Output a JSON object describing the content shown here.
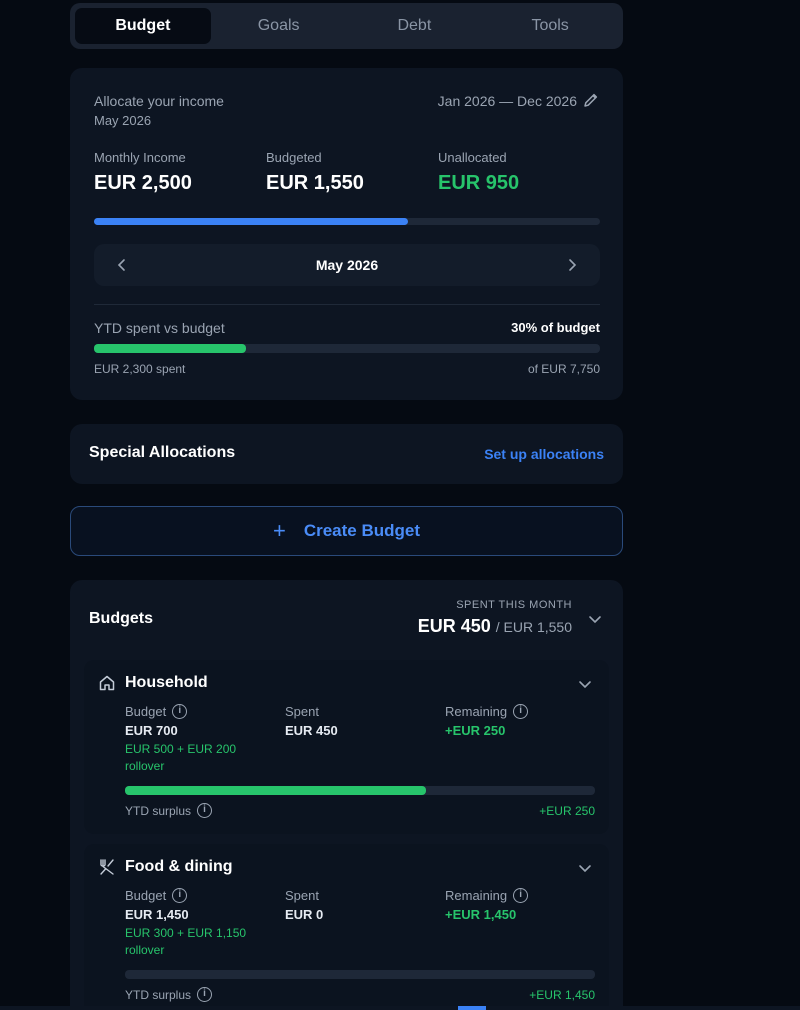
{
  "tabs": [
    "Budget",
    "Goals",
    "Debt",
    "Tools"
  ],
  "income": {
    "title": "Allocate your income",
    "subtitle": "May 2026",
    "range": "Jan 2026 — Dec 2026",
    "monthly_income_label": "Monthly Income",
    "monthly_income_value": "EUR 2,500",
    "budgeted_label": "Budgeted",
    "budgeted_value": "EUR 1,550",
    "unallocated_label": "Unallocated",
    "unallocated_value": "EUR 950",
    "allocation_progress": 0.62,
    "month": "May 2026",
    "ytd_label": "YTD spent vs budget",
    "ytd_percent": "30% of budget",
    "ytd_progress": 0.3,
    "ytd_spent": "EUR 2,300 spent",
    "ytd_total": "of EUR 7,750"
  },
  "special": {
    "title": "Special Allocations",
    "link": "Set up allocations"
  },
  "create_button": "Create Budget",
  "budgets": {
    "title": "Budgets",
    "spent_caption": "SPENT THIS MONTH",
    "spent_value": "EUR 450",
    "spent_total": "/ EUR 1,550",
    "categories": [
      {
        "name": "Household",
        "budget_label": "Budget",
        "budget_value": "EUR 700",
        "budget_note": "EUR 500 + EUR 200 rollover",
        "spent_label": "Spent",
        "spent_value": "EUR 450",
        "remaining_label": "Remaining",
        "remaining_value": "+EUR 250",
        "progress": 0.64,
        "ytd_label": "YTD surplus",
        "ytd_value": "+EUR 250"
      },
      {
        "name": "Food & dining",
        "budget_label": "Budget",
        "budget_value": "EUR 1,450",
        "budget_note": "EUR 300 + EUR 1,150 rollover",
        "spent_label": "Spent",
        "spent_value": "EUR 0",
        "remaining_label": "Remaining",
        "remaining_value": "+EUR 1,450",
        "progress": 0,
        "ytd_label": "YTD surplus",
        "ytd_value": "+EUR 1,450"
      }
    ]
  },
  "colors": {
    "accent": "#3b82f6",
    "positive": "#27c46b",
    "background": "#050a12",
    "card": "#0d1522"
  }
}
